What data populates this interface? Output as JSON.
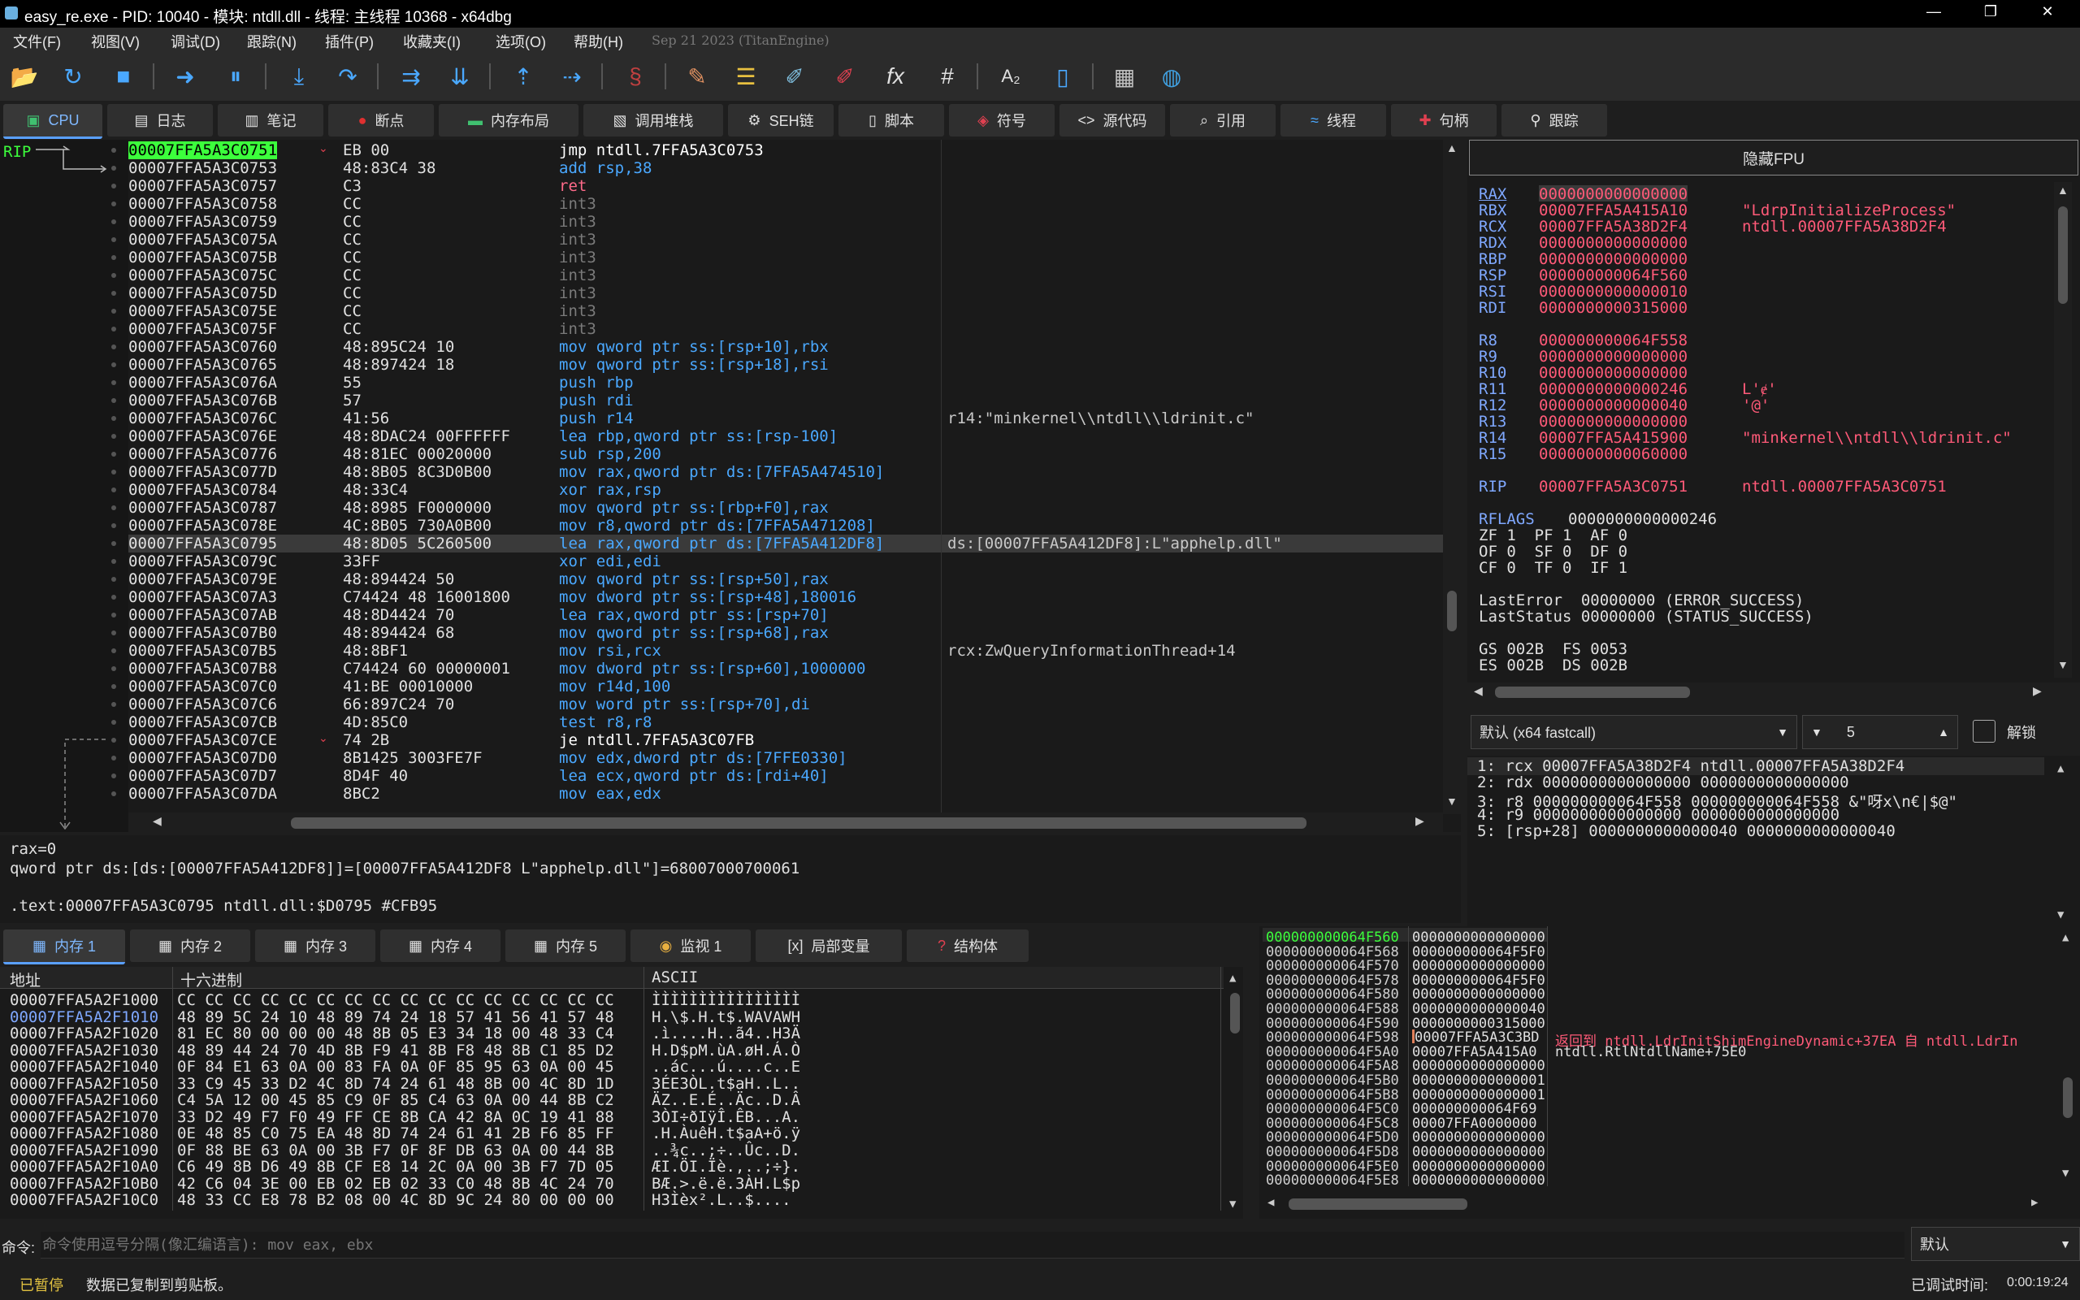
{
  "window": {
    "title": "easy_re.exe - PID: 10040 - 模块: ntdll.dll - 线程: 主线程 10368 - x64dbg",
    "minimize": "—",
    "maximize": "❐",
    "close": "✕"
  },
  "menu": {
    "items": [
      "文件(F)",
      "视图(V)",
      "调试(D)",
      "跟踪(N)",
      "插件(P)",
      "收藏夹(I)",
      "选项(O)",
      "帮助(H)"
    ],
    "build_info": "Sep 21 2023 (TitanEngine)"
  },
  "toolbar": {
    "icons": [
      "open-icon",
      "restart-icon",
      "stop-icon",
      "run-icon",
      "pause-icon",
      "step-into-icon",
      "step-over-icon",
      "trace-into-icon",
      "trace-over-icon",
      "execute-till-return-icon",
      "run-to-user-code-icon",
      "scylla-icon",
      "patch-icon",
      "comment-icon",
      "label-icon",
      "bookmark-icon",
      "function-icon",
      "hash-icon",
      "font-icon",
      "calculator-icon",
      "globe-icon",
      "device-icon"
    ]
  },
  "tabs": [
    {
      "label": "CPU",
      "icon": "cpu-icon"
    },
    {
      "label": "日志",
      "icon": "log-icon"
    },
    {
      "label": "笔记",
      "icon": "notes-icon"
    },
    {
      "label": "断点",
      "icon": "breakpoint-icon"
    },
    {
      "label": "内存布局",
      "icon": "memory-map-icon"
    },
    {
      "label": "调用堆栈",
      "icon": "callstack-icon"
    },
    {
      "label": "SEH链",
      "icon": "seh-icon"
    },
    {
      "label": "脚本",
      "icon": "script-icon"
    },
    {
      "label": "符号",
      "icon": "symbol-icon"
    },
    {
      "label": "源代码",
      "icon": "source-icon"
    },
    {
      "label": "引用",
      "icon": "references-icon"
    },
    {
      "label": "线程",
      "icon": "threads-icon"
    },
    {
      "label": "句柄",
      "icon": "handles-icon"
    },
    {
      "label": "跟踪",
      "icon": "trace-icon"
    }
  ],
  "disasm": {
    "rip_label": "RIP",
    "rows": [
      {
        "addr": "00007FFA5A3C0751",
        "bytes": "EB 00",
        "ins": "jmp ntdll.7FFA5A3C0753",
        "comment": "",
        "kind": "jmp",
        "rip": true
      },
      {
        "addr": "00007FFA5A3C0753",
        "bytes": "48:83C4 38",
        "ins": "add rsp,38",
        "comment": "",
        "kind": "normal"
      },
      {
        "addr": "00007FFA5A3C0757",
        "bytes": "C3",
        "ins": "ret",
        "comment": "",
        "kind": "ret"
      },
      {
        "addr": "00007FFA5A3C0758",
        "bytes": "CC",
        "ins": "int3",
        "comment": "",
        "kind": "int"
      },
      {
        "addr": "00007FFA5A3C0759",
        "bytes": "CC",
        "ins": "int3",
        "comment": "",
        "kind": "int"
      },
      {
        "addr": "00007FFA5A3C075A",
        "bytes": "CC",
        "ins": "int3",
        "comment": "",
        "kind": "int"
      },
      {
        "addr": "00007FFA5A3C075B",
        "bytes": "CC",
        "ins": "int3",
        "comment": "",
        "kind": "int"
      },
      {
        "addr": "00007FFA5A3C075C",
        "bytes": "CC",
        "ins": "int3",
        "comment": "",
        "kind": "int"
      },
      {
        "addr": "00007FFA5A3C075D",
        "bytes": "CC",
        "ins": "int3",
        "comment": "",
        "kind": "int"
      },
      {
        "addr": "00007FFA5A3C075E",
        "bytes": "CC",
        "ins": "int3",
        "comment": "",
        "kind": "int"
      },
      {
        "addr": "00007FFA5A3C075F",
        "bytes": "CC",
        "ins": "int3",
        "comment": "",
        "kind": "int"
      },
      {
        "addr": "00007FFA5A3C0760",
        "bytes": "48:895C24 10",
        "ins": "mov qword ptr ss:[rsp+10],rbx",
        "comment": "",
        "kind": "normal"
      },
      {
        "addr": "00007FFA5A3C0765",
        "bytes": "48:897424 18",
        "ins": "mov qword ptr ss:[rsp+18],rsi",
        "comment": "",
        "kind": "normal"
      },
      {
        "addr": "00007FFA5A3C076A",
        "bytes": "55",
        "ins": "push rbp",
        "comment": "",
        "kind": "normal"
      },
      {
        "addr": "00007FFA5A3C076B",
        "bytes": "57",
        "ins": "push rdi",
        "comment": "",
        "kind": "normal"
      },
      {
        "addr": "00007FFA5A3C076C",
        "bytes": "41:56",
        "ins": "push r14",
        "comment": "r14:\"minkernel\\\\ntdll\\\\ldrinit.c\"",
        "kind": "normal"
      },
      {
        "addr": "00007FFA5A3C076E",
        "bytes": "48:8DAC24 00FFFFFF",
        "ins": "lea rbp,qword ptr ss:[rsp-100]",
        "comment": "",
        "kind": "normal"
      },
      {
        "addr": "00007FFA5A3C0776",
        "bytes": "48:81EC 00020000",
        "ins": "sub rsp,200",
        "comment": "",
        "kind": "normal"
      },
      {
        "addr": "00007FFA5A3C077D",
        "bytes": "48:8B05 8C3D0B00",
        "ins": "mov rax,qword ptr ds:[7FFA5A474510]",
        "comment": "",
        "kind": "normal"
      },
      {
        "addr": "00007FFA5A3C0784",
        "bytes": "48:33C4",
        "ins": "xor rax,rsp",
        "comment": "",
        "kind": "normal"
      },
      {
        "addr": "00007FFA5A3C0787",
        "bytes": "48:8985 F0000000",
        "ins": "mov qword ptr ss:[rbp+F0],rax",
        "comment": "",
        "kind": "normal"
      },
      {
        "addr": "00007FFA5A3C078E",
        "bytes": "4C:8B05 730A0B00",
        "ins": "mov r8,qword ptr ds:[7FFA5A471208]",
        "comment": "",
        "kind": "normal"
      },
      {
        "addr": "00007FFA5A3C0795",
        "bytes": "48:8D05 5C260500",
        "ins": "lea rax,qword ptr ds:[7FFA5A412DF8]",
        "comment": "ds:[00007FFA5A412DF8]:L\"apphelp.dll\"",
        "kind": "normal",
        "selected": true
      },
      {
        "addr": "00007FFA5A3C079C",
        "bytes": "33FF",
        "ins": "xor edi,edi",
        "comment": "",
        "kind": "normal"
      },
      {
        "addr": "00007FFA5A3C079E",
        "bytes": "48:894424 50",
        "ins": "mov qword ptr ss:[rsp+50],rax",
        "comment": "",
        "kind": "normal"
      },
      {
        "addr": "00007FFA5A3C07A3",
        "bytes": "C74424 48 16001800",
        "ins": "mov dword ptr ss:[rsp+48],180016",
        "comment": "",
        "kind": "normal"
      },
      {
        "addr": "00007FFA5A3C07AB",
        "bytes": "48:8D4424 70",
        "ins": "lea rax,qword ptr ss:[rsp+70]",
        "comment": "",
        "kind": "normal"
      },
      {
        "addr": "00007FFA5A3C07B0",
        "bytes": "48:894424 68",
        "ins": "mov qword ptr ss:[rsp+68],rax",
        "comment": "",
        "kind": "normal"
      },
      {
        "addr": "00007FFA5A3C07B5",
        "bytes": "48:8BF1",
        "ins": "mov rsi,rcx",
        "comment": "rcx:ZwQueryInformationThread+14",
        "kind": "normal"
      },
      {
        "addr": "00007FFA5A3C07B8",
        "bytes": "C74424 60 00000001",
        "ins": "mov dword ptr ss:[rsp+60],1000000",
        "comment": "",
        "kind": "normal"
      },
      {
        "addr": "00007FFA5A3C07C0",
        "bytes": "41:BE 00010000",
        "ins": "mov r14d,100",
        "comment": "",
        "kind": "normal"
      },
      {
        "addr": "00007FFA5A3C07C6",
        "bytes": "66:897C24 70",
        "ins": "mov word ptr ss:[rsp+70],di",
        "comment": "",
        "kind": "normal"
      },
      {
        "addr": "00007FFA5A3C07CB",
        "bytes": "4D:85C0",
        "ins": "test r8,r8",
        "comment": "",
        "kind": "normal"
      },
      {
        "addr": "00007FFA5A3C07CE",
        "bytes": "74 2B",
        "ins": "je ntdll.7FFA5A3C07FB",
        "comment": "",
        "kind": "jmp"
      },
      {
        "addr": "00007FFA5A3C07D0",
        "bytes": "8B1425 3003FE7F",
        "ins": "mov edx,dword ptr ds:[7FFE0330]",
        "comment": "",
        "kind": "normal"
      },
      {
        "addr": "00007FFA5A3C07D7",
        "bytes": "8D4F 40",
        "ins": "lea ecx,qword ptr ds:[rdi+40]",
        "comment": "",
        "kind": "normal"
      },
      {
        "addr": "00007FFA5A3C07DA",
        "bytes": "8BC2",
        "ins": "mov eax,edx",
        "comment": "",
        "kind": "normal"
      }
    ]
  },
  "info": {
    "line1": "rax=0",
    "line2": "qword ptr ds:[ds:[00007FFA5A412DF8]]=[00007FFA5A412DF8 L\"apphelp.dll\"]=68007000700061",
    "line3": ".text:00007FFA5A3C0795 ntdll.dll:$D0795 #CFB95"
  },
  "registers": {
    "fpu_button": "隐藏FPU",
    "rows": [
      {
        "name": "RAX",
        "value": "0000000000000000",
        "comment": ""
      },
      {
        "name": "RBX",
        "value": "00007FFA5A415A10",
        "comment": "\"LdrpInitializeProcess\""
      },
      {
        "name": "RCX",
        "value": "00007FFA5A38D2F4",
        "comment": "ntdll.00007FFA5A38D2F4"
      },
      {
        "name": "RDX",
        "value": "0000000000000000",
        "comment": ""
      },
      {
        "name": "RBP",
        "value": "0000000000000000",
        "comment": ""
      },
      {
        "name": "RSP",
        "value": "000000000064F560",
        "comment": ""
      },
      {
        "name": "RSI",
        "value": "0000000000000010",
        "comment": ""
      },
      {
        "name": "RDI",
        "value": "0000000000315000",
        "comment": ""
      },
      {
        "name": "",
        "value": "",
        "comment": ""
      },
      {
        "name": "R8",
        "value": "000000000064F558",
        "comment": ""
      },
      {
        "name": "R9",
        "value": "0000000000000000",
        "comment": ""
      },
      {
        "name": "R10",
        "value": "0000000000000000",
        "comment": ""
      },
      {
        "name": "R11",
        "value": "0000000000000246",
        "comment": "L'ɇ'"
      },
      {
        "name": "R12",
        "value": "0000000000000040",
        "comment": "'@'"
      },
      {
        "name": "R13",
        "value": "0000000000000000",
        "comment": ""
      },
      {
        "name": "R14",
        "value": "00007FFA5A415900",
        "comment": "\"minkernel\\\\ntdll\\\\ldrinit.c\""
      },
      {
        "name": "R15",
        "value": "0000000000060000",
        "comment": ""
      },
      {
        "name": "",
        "value": "",
        "comment": ""
      },
      {
        "name": "RIP",
        "value": "00007FFA5A3C0751",
        "comment": "ntdll.00007FFA5A3C0751"
      }
    ],
    "rflags_label": "RFLAGS",
    "rflags_value": "0000000000000246",
    "flags": [
      "ZF 1  PF 1  AF 0",
      "OF 0  SF 0  DF 0",
      "CF 0  TF 0  IF 1"
    ],
    "lasterror": "LastError  00000000 (ERROR_SUCCESS)",
    "laststatus": "LastStatus 00000000 (STATUS_SUCCESS)",
    "segs": [
      "GS 002B  FS 0053",
      "ES 002B  DS 002B"
    ]
  },
  "callconv": {
    "selected": "默认 (x64 fastcall)",
    "argcount": "5",
    "unlock_label": "解锁",
    "args": [
      "1: rcx 00007FFA5A38D2F4 ntdll.00007FFA5A38D2F4",
      "2: rdx 0000000000000000 0000000000000000",
      "3: r8 000000000064F558 000000000064F558 &\"呀x\\n€|$@\"",
      "4: r9 0000000000000000 0000000000000000",
      "5: [rsp+28] 0000000000000040 0000000000000040"
    ]
  },
  "memtabs": [
    {
      "label": "内存 1",
      "icon": "memory-icon"
    },
    {
      "label": "内存 2",
      "icon": "memory-icon"
    },
    {
      "label": "内存 3",
      "icon": "memory-icon"
    },
    {
      "label": "内存 4",
      "icon": "memory-icon"
    },
    {
      "label": "内存 5",
      "icon": "memory-icon"
    },
    {
      "label": "监视 1",
      "icon": "watch-icon"
    },
    {
      "label": "局部变量",
      "icon": "locals-icon"
    },
    {
      "label": "结构体",
      "icon": "struct-icon"
    }
  ],
  "dump": {
    "col_addr": "地址",
    "col_hex": "十六进制",
    "col_ascii": "ASCII",
    "rows": [
      {
        "addr": "00007FFA5A2F1000",
        "hex": "CC CC CC CC CC CC CC CC CC CC CC CC CC CC CC CC",
        "ascii": "ÌÌÌÌÌÌÌÌÌÌÌÌÌÌÌÌ"
      },
      {
        "addr": "00007FFA5A2F1010",
        "hex": "48 89 5C 24 10 48 89 74 24 18 57 41 56 41 57 48",
        "ascii": "H.\\$.H.t$.WAVAWH"
      },
      {
        "addr": "00007FFA5A2F1020",
        "hex": "81 EC 80 00 00 00 48 8B 05 E3 34 18 00 48 33 C4",
        "ascii": ".ì....H..ã4..H3Ä"
      },
      {
        "addr": "00007FFA5A2F1030",
        "hex": "48 89 44 24 70 4D 8B F9 41 8B F8 48 8B C1 85 D2",
        "ascii": "H.D$pM.ùA.øH.Á.Ò"
      },
      {
        "addr": "00007FFA5A2F1040",
        "hex": "0F 84 E1 63 0A 00 83 FA 0A 0F 85 95 63 0A 00 45",
        "ascii": "..ác...ú....c..E"
      },
      {
        "addr": "00007FFA5A2F1050",
        "hex": "33 C9 45 33 D2 4C 8D 74 24 61 48 8B 00 4C 8D 1D",
        "ascii": "3ÉE3ÒL.t$aH..L.."
      },
      {
        "addr": "00007FFA5A2F1060",
        "hex": "C4 5A 12 00 45 85 C9 0F 85 C4 63 0A 00 44 8B C2",
        "ascii": "ÄZ..E.É..Äc..D.Â"
      },
      {
        "addr": "00007FFA5A2F1070",
        "hex": "33 D2 49 F7 F0 49 FF CE 8B CA 42 8A 0C 19 41 88",
        "ascii": "3ÒI÷ðIÿÎ.ÊB...A."
      },
      {
        "addr": "00007FFA5A2F1080",
        "hex": "0E 48 85 C0 75 EA 48 8D 74 24 61 41 2B F6 85 FF",
        "ascii": ".H.ÀuêH.t$aA+ö.ÿ"
      },
      {
        "addr": "00007FFA5A2F1090",
        "hex": "0F 88 BE 63 0A 00 3B F7 0F 8F DB 63 0A 00 44 8B",
        "ascii": "..¾c..;÷..Ûc..D."
      },
      {
        "addr": "00007FFA5A2F10A0",
        "hex": "C6 49 8B D6 49 8B CF E8 14 2C 0A 00 3B F7 7D 05",
        "ascii": "ÆI.ÖI.Ïè.,..;÷}."
      },
      {
        "addr": "00007FFA5A2F10B0",
        "hex": "42 C6 04 3E 00 EB 02 EB 02 33 C0 48 8B 4C 24 70",
        "ascii": "BÆ.>.ë.ë.3ÀH.L$p"
      },
      {
        "addr": "00007FFA5A2F10C0",
        "hex": "48 33 CC E8 78 B2 08 00 4C 8D 9C 24 80 00 00 00",
        "ascii": "H3Ìèx².L..$...."
      }
    ]
  },
  "stack": {
    "rows": [
      {
        "a": "000000000064F560",
        "v": "0000000000000000",
        "c": ""
      },
      {
        "a": "000000000064F568",
        "v": "000000000064F5F0",
        "c": ""
      },
      {
        "a": "000000000064F570",
        "v": "0000000000000000",
        "c": ""
      },
      {
        "a": "000000000064F578",
        "v": "000000000064F5F0",
        "c": ""
      },
      {
        "a": "000000000064F580",
        "v": "0000000000000000",
        "c": ""
      },
      {
        "a": "000000000064F588",
        "v": "0000000000000040",
        "c": ""
      },
      {
        "a": "000000000064F590",
        "v": "0000000000315000",
        "c": ""
      },
      {
        "a": "000000000064F598",
        "v": "00007FFA5A3C3BD",
        "c": "返回到 ntdll.LdrInitShimEngineDynamic+37EA 自 ntdll.LdrIn"
      },
      {
        "a": "000000000064F5A0",
        "v": "00007FFA5A415A0",
        "c": "ntdll.RtlNtdllName+75E0"
      },
      {
        "a": "000000000064F5A8",
        "v": "0000000000000000",
        "c": ""
      },
      {
        "a": "000000000064F5B0",
        "v": "0000000000000001",
        "c": ""
      },
      {
        "a": "000000000064F5B8",
        "v": "0000000000000001",
        "c": ""
      },
      {
        "a": "000000000064F5C0",
        "v": "000000000064F69",
        "c": ""
      },
      {
        "a": "000000000064F5C8",
        "v": "00007FFA0000000",
        "c": ""
      },
      {
        "a": "000000000064F5D0",
        "v": "0000000000000000",
        "c": ""
      },
      {
        "a": "000000000064F5D8",
        "v": "0000000000000000",
        "c": ""
      },
      {
        "a": "000000000064F5E0",
        "v": "0000000000000000",
        "c": ""
      },
      {
        "a": "000000000064F5E8",
        "v": "0000000000000000",
        "c": ""
      }
    ]
  },
  "command": {
    "label": "命令:",
    "placeholder": "命令使用逗号分隔(像汇编语言): mov eax, ebx",
    "mode": "默认"
  },
  "status": {
    "state": "已暂停",
    "message": "数据已复制到剪贴板。",
    "time_label": "已调试时间:",
    "time": "0:00:19:24"
  },
  "colors": {
    "accent": "#5aa0ff",
    "register_value": "#ff5a78",
    "register_name": "#7fa8ff",
    "instruction": "#4aa8ff",
    "rip_highlight": "#3cff3c",
    "paused": "#e0c040"
  }
}
